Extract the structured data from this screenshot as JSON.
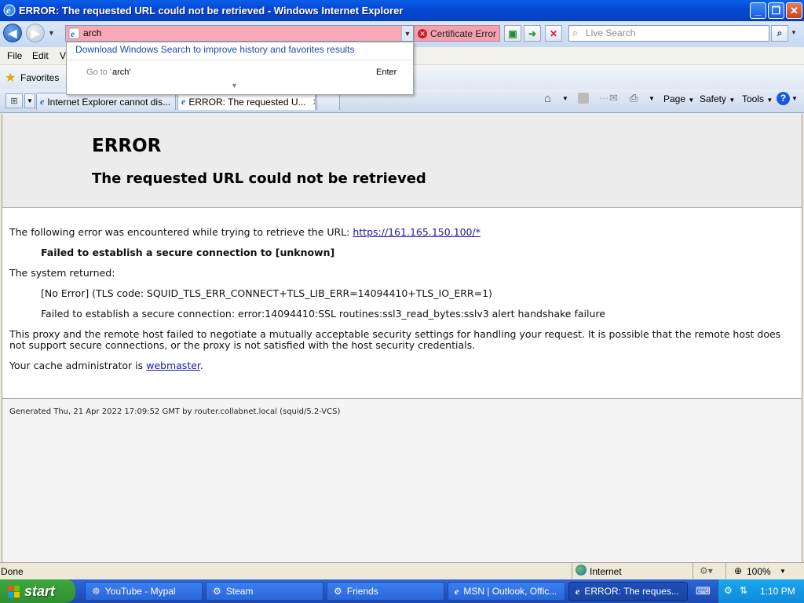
{
  "window": {
    "title": "ERROR: The requested URL could not be retrieved - Windows Internet Explorer"
  },
  "address": {
    "value": "arch",
    "certificate_error": "Certificate Error",
    "search_placeholder": "Live Search"
  },
  "autocomplete": {
    "link": "Download Windows Search to improve history and favorites results",
    "goto_label": "Go to '",
    "goto_term": "arch'",
    "enter_label": "Enter"
  },
  "menu": {
    "items": [
      "File",
      "Edit",
      "Vi"
    ]
  },
  "favorites": {
    "label": "Favorites"
  },
  "tabs": [
    {
      "label": "Internet Explorer cannot dis..."
    },
    {
      "label": "ERROR: The requested U..."
    }
  ],
  "commands": {
    "page": "Page",
    "safety": "Safety",
    "tools": "Tools"
  },
  "page": {
    "h1": "ERROR",
    "h2": "The requested URL could not be retrieved",
    "line1_prefix": "The following error was encountered while trying to retrieve the URL: ",
    "url": "https://161.165.150.100/*",
    "error_bold": "Failed to establish a secure connection to [unknown]",
    "system_returned": "The system returned:",
    "tls_code": "[No Error] (TLS code: SQUID_TLS_ERR_CONNECT+TLS_LIB_ERR=14094410+TLS_IO_ERR=1)",
    "ssl_error": "Failed to establish a secure connection: error:14094410:SSL routines:ssl3_read_bytes:sslv3 alert handshake failure",
    "explanation_1": "This proxy and the remote host failed to negotiate a mutually acceptable security settings for handling your request. It is possible that the remote host does",
    "explanation_2": "not support secure connections, or the proxy is not satisfied with the host security credentials.",
    "admin_prefix": "Your cache administrator is ",
    "admin_link": "webmaster",
    "admin_suffix": ".",
    "footer": "Generated Thu, 21 Apr 2022 17:09:52 GMT by router.collabnet.local (squid/5.2-VCS)"
  },
  "status": {
    "text": "Done",
    "zone": "Internet",
    "zoom": "100%"
  },
  "taskbar": {
    "start": "start",
    "items": [
      "YouTube - Mypal",
      "Steam",
      "Friends",
      "MSN | Outlook, Offic...",
      "ERROR: The reques..."
    ],
    "clock": "1:10 PM"
  }
}
